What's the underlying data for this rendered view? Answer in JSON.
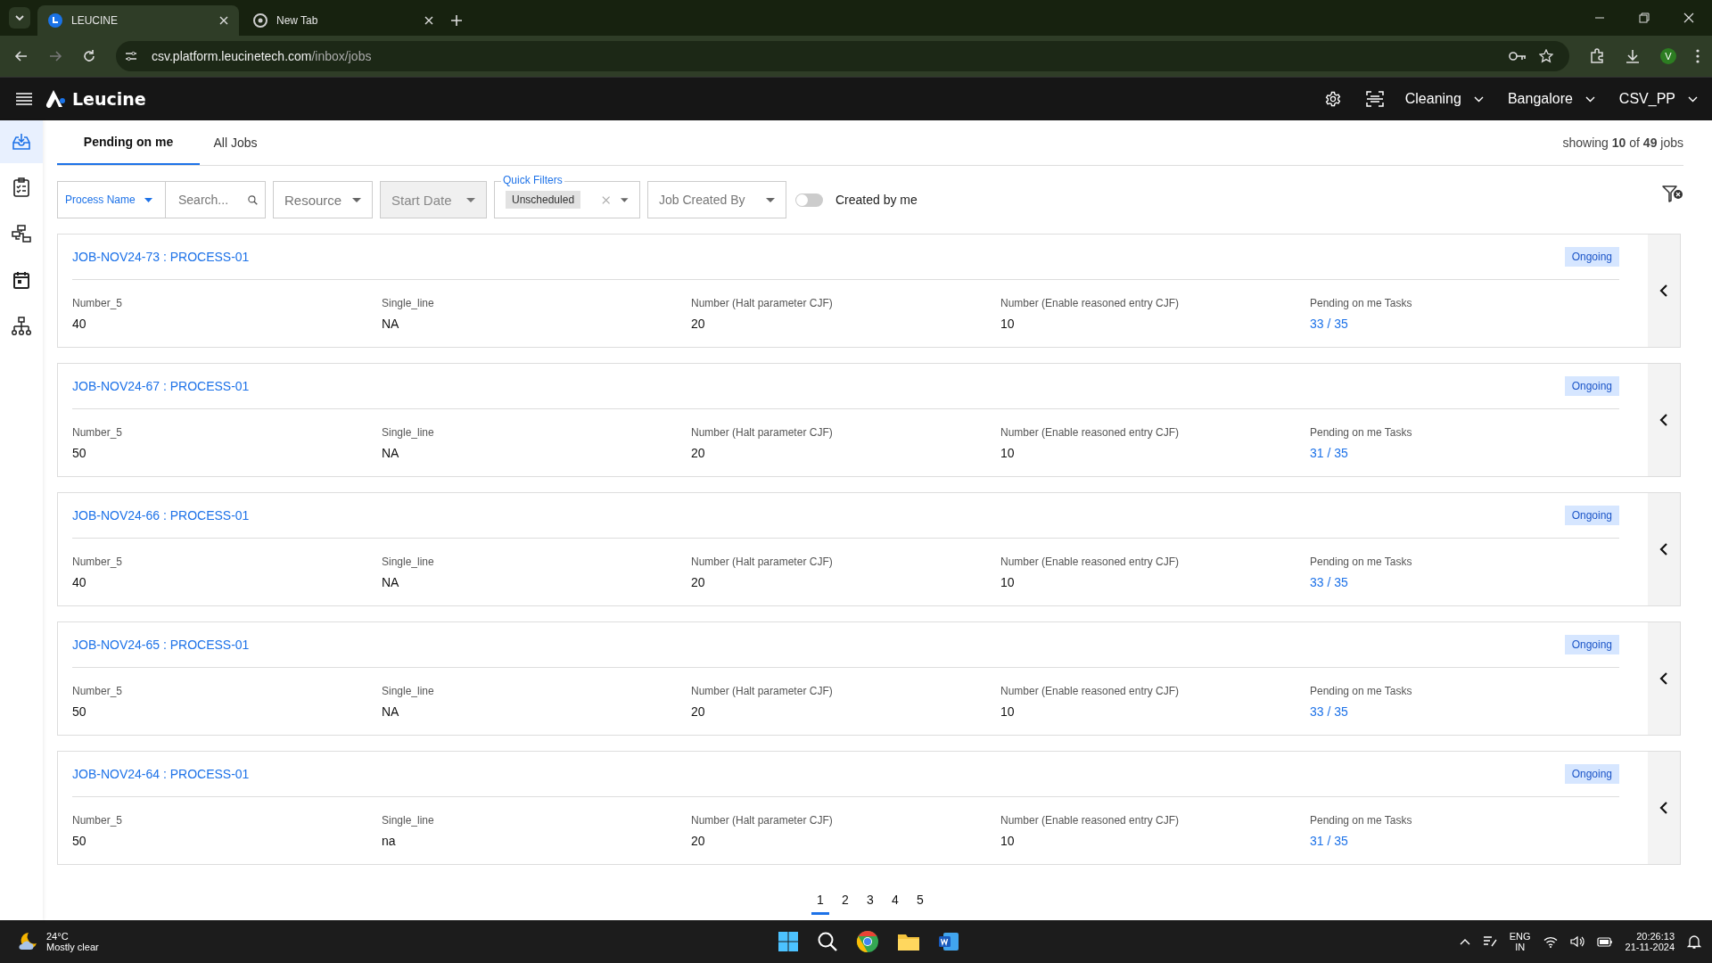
{
  "browser": {
    "tabs": [
      {
        "title": "LEUCINE",
        "kind": "app",
        "selected": true
      },
      {
        "title": "New Tab",
        "kind": "chrome",
        "selected": false
      }
    ],
    "url": {
      "host": "csv.platform.leucinetech.com",
      "path": "/inbox/jobs"
    },
    "profile": "V"
  },
  "header": {
    "brand": "Leucine",
    "menus": [
      {
        "label": "Cleaning"
      },
      {
        "label": "Bangalore"
      },
      {
        "label": "CSV_PP"
      }
    ]
  },
  "sidebar": {
    "items": [
      {
        "kind": "inbox",
        "selected": true
      },
      {
        "kind": "checklist",
        "selected": false
      },
      {
        "kind": "flow",
        "selected": false
      },
      {
        "kind": "calendar",
        "selected": false
      },
      {
        "kind": "hierarchy",
        "selected": false
      }
    ]
  },
  "tabs": [
    {
      "label": "Pending on me",
      "selected": true
    },
    {
      "label": "All Jobs",
      "selected": false
    }
  ],
  "summary": "showing **10** of **49** jobs",
  "filters": {
    "process_name": "Process Name",
    "search": {
      "placeholder": "Search..."
    },
    "resource": {
      "placeholder": "Resource"
    },
    "start_date": {
      "placeholder": "Start Date",
      "disabled": true
    },
    "quick_filters": {
      "label": "Quick Filters",
      "chip": "Unscheduled"
    },
    "job_created_by": {
      "placeholder": "Job Created By"
    },
    "created_by_me": {
      "label": "Created by me",
      "on": false
    }
  },
  "jobs": [
    {
      "title": "JOB-NOV24-73 : PROCESS-01",
      "status": "Ongoing",
      "fields": [
        {
          "label": "Number_5",
          "value": "40",
          "kind": "text"
        },
        {
          "label": "Single_line",
          "value": "NA",
          "kind": "text"
        },
        {
          "label": "Number (Halt parameter CJF)",
          "value": "20",
          "kind": "text"
        },
        {
          "label": "Number (Enable reasoned entry CJF)",
          "value": "10",
          "kind": "text"
        },
        {
          "label": "Pending on me Tasks",
          "value": "33 / 35",
          "kind": "link"
        }
      ]
    },
    {
      "title": "JOB-NOV24-67 : PROCESS-01",
      "status": "Ongoing",
      "fields": [
        {
          "label": "Number_5",
          "value": "50",
          "kind": "text"
        },
        {
          "label": "Single_line",
          "value": "NA",
          "kind": "text"
        },
        {
          "label": "Number (Halt parameter CJF)",
          "value": "20",
          "kind": "text"
        },
        {
          "label": "Number (Enable reasoned entry CJF)",
          "value": "10",
          "kind": "text"
        },
        {
          "label": "Pending on me Tasks",
          "value": "31 / 35",
          "kind": "link"
        }
      ]
    },
    {
      "title": "JOB-NOV24-66 : PROCESS-01",
      "status": "Ongoing",
      "fields": [
        {
          "label": "Number_5",
          "value": "40",
          "kind": "text"
        },
        {
          "label": "Single_line",
          "value": "NA",
          "kind": "text"
        },
        {
          "label": "Number (Halt parameter CJF)",
          "value": "20",
          "kind": "text"
        },
        {
          "label": "Number (Enable reasoned entry CJF)",
          "value": "10",
          "kind": "text"
        },
        {
          "label": "Pending on me Tasks",
          "value": "33 / 35",
          "kind": "link"
        }
      ]
    },
    {
      "title": "JOB-NOV24-65 : PROCESS-01",
      "status": "Ongoing",
      "fields": [
        {
          "label": "Number_5",
          "value": "50",
          "kind": "text"
        },
        {
          "label": "Single_line",
          "value": "NA",
          "kind": "text"
        },
        {
          "label": "Number (Halt parameter CJF)",
          "value": "20",
          "kind": "text"
        },
        {
          "label": "Number (Enable reasoned entry CJF)",
          "value": "10",
          "kind": "text"
        },
        {
          "label": "Pending on me Tasks",
          "value": "33 / 35",
          "kind": "link"
        }
      ]
    },
    {
      "title": "JOB-NOV24-64 : PROCESS-01",
      "status": "Ongoing",
      "fields": [
        {
          "label": "Number_5",
          "value": "50",
          "kind": "text"
        },
        {
          "label": "Single_line",
          "value": "na",
          "kind": "text"
        },
        {
          "label": "Number (Halt parameter CJF)",
          "value": "20",
          "kind": "text"
        },
        {
          "label": "Number (Enable reasoned entry CJF)",
          "value": "10",
          "kind": "text"
        },
        {
          "label": "Pending on me Tasks",
          "value": "31 / 35",
          "kind": "link"
        }
      ]
    }
  ],
  "pagination": [
    {
      "label": "1",
      "selected": true
    },
    {
      "label": "2",
      "selected": false
    },
    {
      "label": "3",
      "selected": false
    },
    {
      "label": "4",
      "selected": false
    },
    {
      "label": "5",
      "selected": false
    }
  ],
  "taskbar": {
    "weather": {
      "temp": "24°C",
      "text": "Mostly clear"
    },
    "apps": [
      {
        "kind": "start"
      },
      {
        "kind": "search"
      },
      {
        "kind": "chrome"
      },
      {
        "kind": "folder"
      },
      {
        "kind": "word"
      }
    ],
    "lang": [
      "ENG",
      "IN"
    ],
    "time": "20:26:13",
    "date": "21-11-2024"
  }
}
